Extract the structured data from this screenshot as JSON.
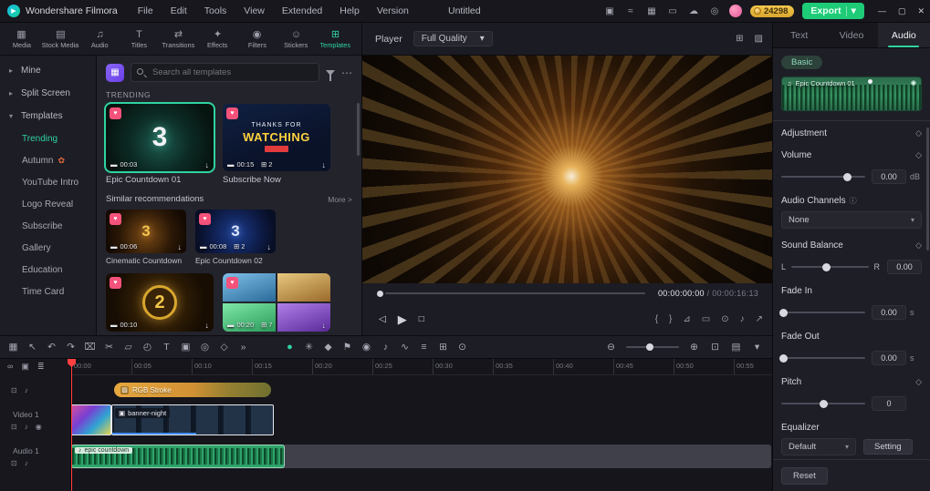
{
  "titlebar": {
    "app_name": "Wondershare Filmora",
    "menus": [
      "File",
      "Edit",
      "Tools",
      "View",
      "Extended",
      "Help",
      "Version"
    ],
    "project_title": "Untitled",
    "coins": "24298",
    "export_label": "Export"
  },
  "tb_icons": [
    {
      "name": "gift",
      "g": "▣"
    },
    {
      "name": "promo",
      "g": "≈"
    },
    {
      "name": "apps",
      "g": "▦"
    },
    {
      "name": "display",
      "g": "▭"
    },
    {
      "name": "cloud",
      "g": "☁"
    },
    {
      "name": "bell",
      "g": "◎"
    }
  ],
  "media_tabs": [
    {
      "label": "Media",
      "glyph": "▦"
    },
    {
      "label": "Stock Media",
      "glyph": "▤"
    },
    {
      "label": "Audio",
      "glyph": "♫"
    },
    {
      "label": "Titles",
      "glyph": "T"
    },
    {
      "label": "Transitions",
      "glyph": "⇄"
    },
    {
      "label": "Effects",
      "glyph": "✦"
    },
    {
      "label": "Filters",
      "glyph": "◉"
    },
    {
      "label": "Stickers",
      "glyph": "☺"
    },
    {
      "label": "Templates",
      "glyph": "⊞"
    }
  ],
  "sidebar": {
    "groups": [
      {
        "label": "Mine"
      },
      {
        "label": "Split Screen"
      },
      {
        "label": "Templates"
      }
    ],
    "items": [
      {
        "label": "Trending"
      },
      {
        "label": "Autumn"
      },
      {
        "label": "YouTube Intro"
      },
      {
        "label": "Logo Reveal"
      },
      {
        "label": "Subscribe"
      },
      {
        "label": "Gallery"
      },
      {
        "label": "Education"
      },
      {
        "label": "Time Card"
      }
    ]
  },
  "templates": {
    "search_placeholder": "Search all templates",
    "trending_title": "TRENDING",
    "similar_title": "Similar recommendations",
    "more_label": "More >",
    "cards": [
      {
        "name": "Epic Countdown 01",
        "duration": "00:03",
        "big_text": "3"
      },
      {
        "name": "Subscribe Now",
        "duration": "00:15",
        "clips": "2",
        "line1": "THANKS FOR",
        "line2": "WATCHING"
      }
    ],
    "similar_cards": [
      {
        "name": "Cinematic Countdown",
        "duration": "00:06",
        "big_text": "3"
      },
      {
        "name": "Epic Countdown 02",
        "duration": "00:08",
        "clips": "2",
        "big_text": "3"
      }
    ],
    "bottom_cards": [
      {
        "duration": "00:10",
        "big_text": "2"
      },
      {
        "duration": "00:20",
        "clips": "7"
      }
    ]
  },
  "player": {
    "label": "Player",
    "quality": "Full Quality",
    "time_current": "00:00:00:00",
    "time_sep": " / ",
    "time_total": "00:00:16:13"
  },
  "props": {
    "tabs": [
      "Text",
      "Video",
      "Audio"
    ],
    "basic": "Basic",
    "clip_name": "Epic Countdown 01",
    "adjustment": "Adjustment",
    "volume_label": "Volume",
    "volume_value": "0.00",
    "volume_unit": "dB",
    "channels_label": "Audio Channels",
    "channels_value": "None",
    "balance_label": "Sound Balance",
    "balance_l": "L",
    "balance_r": "R",
    "balance_value": "0.00",
    "fadein_label": "Fade In",
    "fadein_value": "0.00",
    "fadein_unit": "s",
    "fadeout_label": "Fade Out",
    "fadeout_value": "0.00",
    "fadeout_unit": "s",
    "pitch_label": "Pitch",
    "pitch_value": "0",
    "eq_label": "Equalizer",
    "eq_value": "Default",
    "eq_button": "Setting",
    "reset": "Reset"
  },
  "tt": {
    "left": [
      {
        "n": "media-browser",
        "g": "▦"
      },
      {
        "n": "pointer",
        "g": "↖"
      },
      {
        "n": "undo",
        "g": "↶"
      },
      {
        "n": "redo",
        "g": "↷"
      },
      {
        "n": "delete",
        "g": "⌧"
      },
      {
        "n": "split",
        "g": "✂"
      },
      {
        "n": "crop",
        "g": "▱"
      },
      {
        "n": "speed",
        "g": "◴"
      },
      {
        "n": "text",
        "g": "T"
      },
      {
        "n": "pip",
        "g": "▣"
      },
      {
        "n": "motion-track",
        "g": "◎"
      },
      {
        "n": "keyframe-add",
        "g": "◇"
      },
      {
        "n": "more-tools",
        "g": "»"
      }
    ],
    "center": [
      {
        "n": "chroma-key",
        "g": "●"
      },
      {
        "n": "freeze-frame",
        "g": "✳"
      },
      {
        "n": "keyframe",
        "g": "◆"
      },
      {
        "n": "marker",
        "g": "⚑"
      },
      {
        "n": "record",
        "g": "◉"
      },
      {
        "n": "voiceover",
        "g": "♪"
      },
      {
        "n": "audio-sync",
        "g": "∿"
      },
      {
        "n": "mixer",
        "g": "≡"
      },
      {
        "n": "snap",
        "g": "⊞"
      },
      {
        "n": "render-preview",
        "g": "⊙"
      }
    ],
    "right": [
      {
        "n": "zoom-out",
        "g": "⊖"
      },
      {
        "n": "zoom-in",
        "g": "⊕"
      },
      {
        "n": "zoom-fit",
        "g": "⊡"
      },
      {
        "n": "track-manage",
        "g": "▤"
      },
      {
        "n": "collapse",
        "g": "▾"
      }
    ]
  },
  "timeline": {
    "ruler": [
      "00:00",
      "00:05",
      "00:10",
      "00:15",
      "00:20",
      "00:25",
      "00:30",
      "00:35",
      "00:40",
      "00:45",
      "00:50",
      "00:55"
    ],
    "video_track": "Video 1",
    "audio_track": "Audio 1",
    "clips": {
      "fx": "RGB Stroke",
      "video": "banner-night",
      "audio": "epic countdown"
    }
  },
  "ui": {
    "caret_down": "▾",
    "caret_right": "▸",
    "more": "⋯",
    "info": "ⓘ",
    "diamond": "◇",
    "heart": "♥",
    "download": "↓",
    "clapper": "▬",
    "clips": "⊞",
    "note": "♫",
    "note_sm": "♪",
    "play": "▶",
    "prev": "◁",
    "stop": "□",
    "min": "—",
    "max": "▢",
    "close": "✕",
    "leaf": "✿",
    "fx": "▨",
    "thumb": "▣",
    "link": "∞",
    "range": "▣",
    "list": "≣",
    "lock": "⊡",
    "mute": "♪",
    "eye": "◉",
    "compare": "⊞",
    "scopes": "▨",
    "mark_in": "{",
    "mark_out": "}",
    "scope": "⊿",
    "aspect": "▭",
    "snapshot": "⊙",
    "speaker": "♪",
    "fullscreen": "↗",
    "template_badge": "▦",
    "clip_speaker": "◉"
  }
}
